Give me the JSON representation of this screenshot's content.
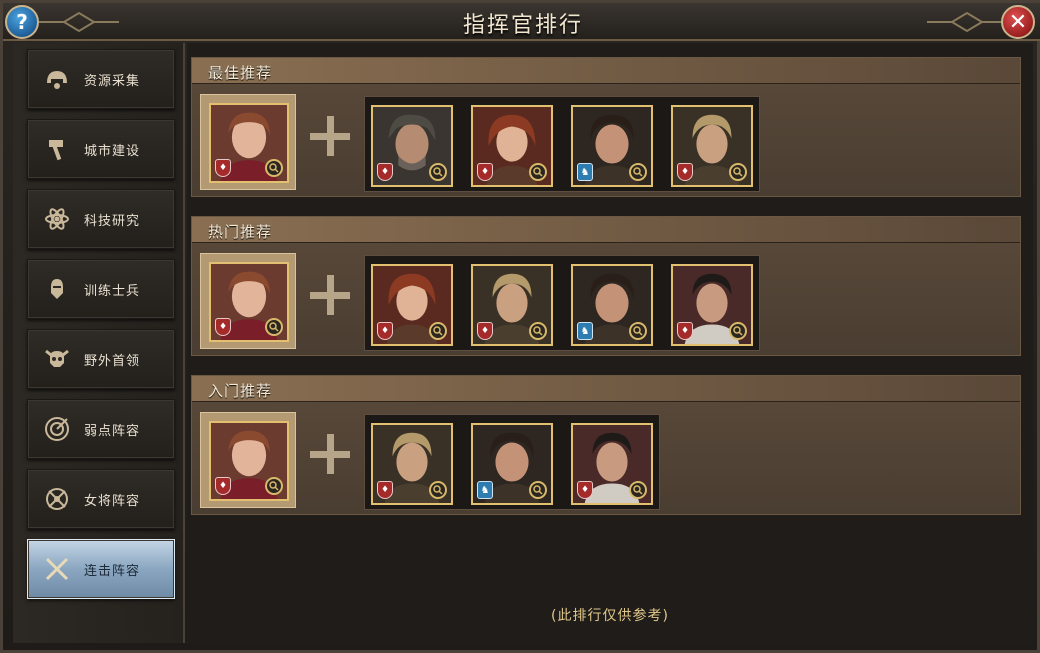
{
  "window": {
    "title": "指挥官排行"
  },
  "buttons": {
    "help_label": "?",
    "close_label": "✕"
  },
  "sidebar": {
    "items": [
      {
        "label": "资源采集",
        "icon": "helmet-icon",
        "active": false
      },
      {
        "label": "城市建设",
        "icon": "hammer-icon",
        "active": false
      },
      {
        "label": "科技研究",
        "icon": "atom-icon",
        "active": false
      },
      {
        "label": "训练士兵",
        "icon": "soldier-icon",
        "active": false
      },
      {
        "label": "野外首领",
        "icon": "skull-icon",
        "active": false
      },
      {
        "label": "弱点阵容",
        "icon": "target-icon",
        "active": false
      },
      {
        "label": "女将阵容",
        "icon": "emblem-icon",
        "active": false
      },
      {
        "label": "连击阵容",
        "icon": "swords-icon",
        "active": true
      }
    ]
  },
  "sections": [
    {
      "title": "最佳推荐",
      "main": {
        "badge": "shield"
      },
      "team": [
        {
          "badge": "shield"
        },
        {
          "badge": "shield"
        },
        {
          "badge": "horse"
        },
        {
          "badge": "shield"
        }
      ]
    },
    {
      "title": "热门推荐",
      "main": {
        "badge": "shield"
      },
      "team": [
        {
          "badge": "shield"
        },
        {
          "badge": "shield"
        },
        {
          "badge": "horse"
        },
        {
          "badge": "shield"
        }
      ]
    },
    {
      "title": "入门推荐",
      "main": {
        "badge": "shield"
      },
      "team": [
        {
          "badge": "shield"
        },
        {
          "badge": "horse"
        },
        {
          "badge": "shield"
        }
      ]
    }
  ],
  "footer": {
    "note": "(此排行仅供参考)"
  },
  "colors": {
    "gold": "#e3c070",
    "accent_blue": "#8aa6c0",
    "shield_red": "#a52a2a",
    "horse_blue": "#2e7cb0"
  }
}
